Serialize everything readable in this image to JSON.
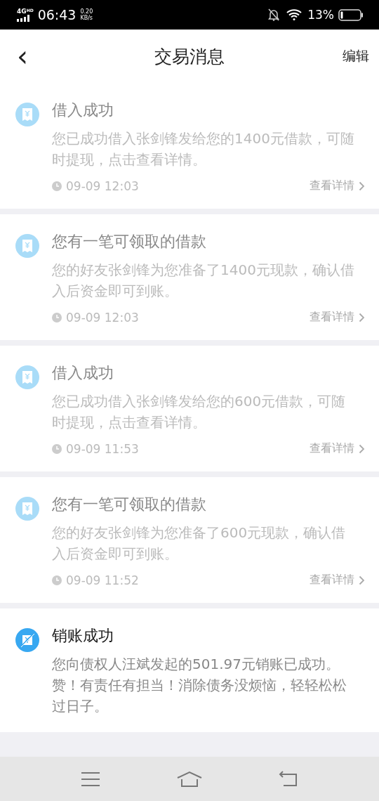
{
  "status_bar": {
    "network": "4G",
    "network_tag": "HD",
    "time": "06:43",
    "speed": "0.20",
    "speed_unit": "KB/s",
    "battery": "13%"
  },
  "header": {
    "back": "‹",
    "title": "交易消息",
    "action": "编辑"
  },
  "messages": [
    {
      "kind": "receipt",
      "read": true,
      "title": "借入成功",
      "body": "您已成功借入张剑锋发给您的1400元借款，可随时提现，点击查看详情。",
      "time": "09-09 12:03",
      "link": "查看详情"
    },
    {
      "kind": "receipt",
      "read": true,
      "title": "您有一笔可领取的借款",
      "body": "您的好友张剑锋为您准备了1400元现款，确认借入后资金即可到账。",
      "time": "09-09 12:03",
      "link": "查看详情"
    },
    {
      "kind": "receipt",
      "read": true,
      "title": "借入成功",
      "body": "您已成功借入张剑锋发给您的600元借款，可随时提现，点击查看详情。",
      "time": "09-09 11:53",
      "link": "查看详情"
    },
    {
      "kind": "receipt",
      "read": true,
      "title": "您有一笔可领取的借款",
      "body": "您的好友张剑锋为您准备了600元现款，确认借入后资金即可到账。",
      "time": "09-09 11:52",
      "link": "查看详情"
    },
    {
      "kind": "writeoff",
      "read": false,
      "title": "销账成功",
      "body": "您向债权人汪斌发起的501.97元销账已成功。赞！有责任有担当！消除债务没烦恼，轻轻松松过日子。"
    }
  ]
}
